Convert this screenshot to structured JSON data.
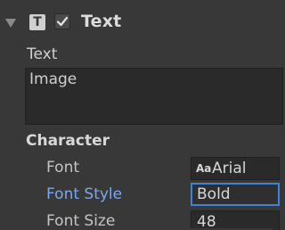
{
  "component": {
    "title": "Text",
    "icon": "text-component-icon",
    "enabled": true,
    "icon_glyph": "T"
  },
  "text_field": {
    "label": "Text",
    "value": "Image"
  },
  "character": {
    "title": "Character",
    "font": {
      "label": "Font",
      "value": "Arial",
      "icon_glyph": "Aa"
    },
    "font_style": {
      "label": "Font Style",
      "value": "Bold"
    },
    "font_size": {
      "label": "Font Size",
      "value": "48"
    }
  },
  "colors": {
    "background": "#383838",
    "highlight_label": "#7ba6f0",
    "focus_border": "#3d84d6",
    "field_background": "#2a2a2a"
  }
}
